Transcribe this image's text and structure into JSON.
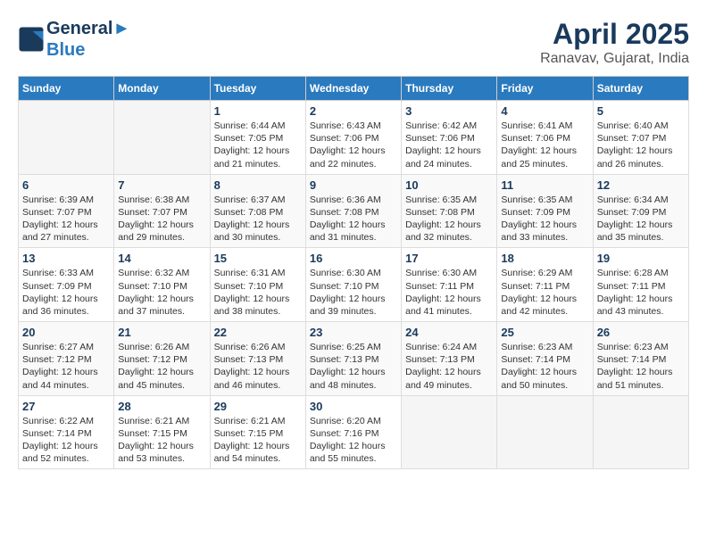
{
  "header": {
    "logo_line1": "General",
    "logo_line2": "Blue",
    "month_title": "April 2025",
    "location": "Ranavav, Gujarat, India"
  },
  "weekdays": [
    "Sunday",
    "Monday",
    "Tuesday",
    "Wednesday",
    "Thursday",
    "Friday",
    "Saturday"
  ],
  "weeks": [
    [
      {
        "day": "",
        "info": ""
      },
      {
        "day": "",
        "info": ""
      },
      {
        "day": "1",
        "info": "Sunrise: 6:44 AM\nSunset: 7:05 PM\nDaylight: 12 hours and 21 minutes."
      },
      {
        "day": "2",
        "info": "Sunrise: 6:43 AM\nSunset: 7:06 PM\nDaylight: 12 hours and 22 minutes."
      },
      {
        "day": "3",
        "info": "Sunrise: 6:42 AM\nSunset: 7:06 PM\nDaylight: 12 hours and 24 minutes."
      },
      {
        "day": "4",
        "info": "Sunrise: 6:41 AM\nSunset: 7:06 PM\nDaylight: 12 hours and 25 minutes."
      },
      {
        "day": "5",
        "info": "Sunrise: 6:40 AM\nSunset: 7:07 PM\nDaylight: 12 hours and 26 minutes."
      }
    ],
    [
      {
        "day": "6",
        "info": "Sunrise: 6:39 AM\nSunset: 7:07 PM\nDaylight: 12 hours and 27 minutes."
      },
      {
        "day": "7",
        "info": "Sunrise: 6:38 AM\nSunset: 7:07 PM\nDaylight: 12 hours and 29 minutes."
      },
      {
        "day": "8",
        "info": "Sunrise: 6:37 AM\nSunset: 7:08 PM\nDaylight: 12 hours and 30 minutes."
      },
      {
        "day": "9",
        "info": "Sunrise: 6:36 AM\nSunset: 7:08 PM\nDaylight: 12 hours and 31 minutes."
      },
      {
        "day": "10",
        "info": "Sunrise: 6:35 AM\nSunset: 7:08 PM\nDaylight: 12 hours and 32 minutes."
      },
      {
        "day": "11",
        "info": "Sunrise: 6:35 AM\nSunset: 7:09 PM\nDaylight: 12 hours and 33 minutes."
      },
      {
        "day": "12",
        "info": "Sunrise: 6:34 AM\nSunset: 7:09 PM\nDaylight: 12 hours and 35 minutes."
      }
    ],
    [
      {
        "day": "13",
        "info": "Sunrise: 6:33 AM\nSunset: 7:09 PM\nDaylight: 12 hours and 36 minutes."
      },
      {
        "day": "14",
        "info": "Sunrise: 6:32 AM\nSunset: 7:10 PM\nDaylight: 12 hours and 37 minutes."
      },
      {
        "day": "15",
        "info": "Sunrise: 6:31 AM\nSunset: 7:10 PM\nDaylight: 12 hours and 38 minutes."
      },
      {
        "day": "16",
        "info": "Sunrise: 6:30 AM\nSunset: 7:10 PM\nDaylight: 12 hours and 39 minutes."
      },
      {
        "day": "17",
        "info": "Sunrise: 6:30 AM\nSunset: 7:11 PM\nDaylight: 12 hours and 41 minutes."
      },
      {
        "day": "18",
        "info": "Sunrise: 6:29 AM\nSunset: 7:11 PM\nDaylight: 12 hours and 42 minutes."
      },
      {
        "day": "19",
        "info": "Sunrise: 6:28 AM\nSunset: 7:11 PM\nDaylight: 12 hours and 43 minutes."
      }
    ],
    [
      {
        "day": "20",
        "info": "Sunrise: 6:27 AM\nSunset: 7:12 PM\nDaylight: 12 hours and 44 minutes."
      },
      {
        "day": "21",
        "info": "Sunrise: 6:26 AM\nSunset: 7:12 PM\nDaylight: 12 hours and 45 minutes."
      },
      {
        "day": "22",
        "info": "Sunrise: 6:26 AM\nSunset: 7:13 PM\nDaylight: 12 hours and 46 minutes."
      },
      {
        "day": "23",
        "info": "Sunrise: 6:25 AM\nSunset: 7:13 PM\nDaylight: 12 hours and 48 minutes."
      },
      {
        "day": "24",
        "info": "Sunrise: 6:24 AM\nSunset: 7:13 PM\nDaylight: 12 hours and 49 minutes."
      },
      {
        "day": "25",
        "info": "Sunrise: 6:23 AM\nSunset: 7:14 PM\nDaylight: 12 hours and 50 minutes."
      },
      {
        "day": "26",
        "info": "Sunrise: 6:23 AM\nSunset: 7:14 PM\nDaylight: 12 hours and 51 minutes."
      }
    ],
    [
      {
        "day": "27",
        "info": "Sunrise: 6:22 AM\nSunset: 7:14 PM\nDaylight: 12 hours and 52 minutes."
      },
      {
        "day": "28",
        "info": "Sunrise: 6:21 AM\nSunset: 7:15 PM\nDaylight: 12 hours and 53 minutes."
      },
      {
        "day": "29",
        "info": "Sunrise: 6:21 AM\nSunset: 7:15 PM\nDaylight: 12 hours and 54 minutes."
      },
      {
        "day": "30",
        "info": "Sunrise: 6:20 AM\nSunset: 7:16 PM\nDaylight: 12 hours and 55 minutes."
      },
      {
        "day": "",
        "info": ""
      },
      {
        "day": "",
        "info": ""
      },
      {
        "day": "",
        "info": ""
      }
    ]
  ]
}
